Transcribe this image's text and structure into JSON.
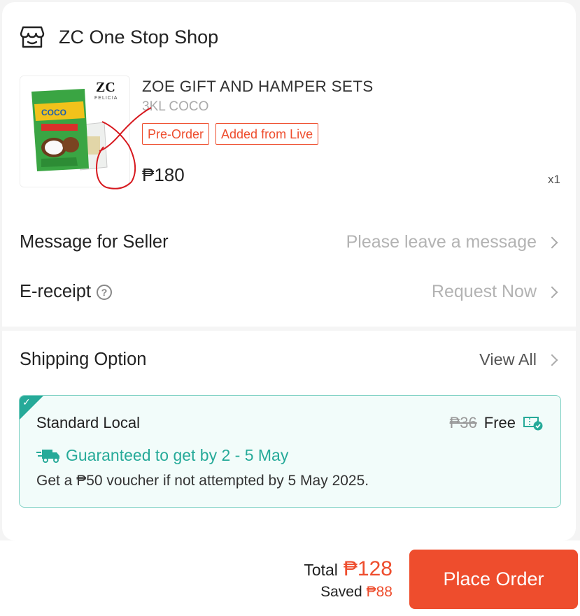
{
  "shop": {
    "name": "ZC One Stop Shop",
    "icon": "store-icon"
  },
  "product": {
    "brand_logo": "ZC",
    "brand_sub": "FELICIA",
    "title": "ZOE GIFT AND HAMPER SETS",
    "variant": "3KL COCO",
    "tags": [
      "Pre-Order",
      "Added from Live"
    ],
    "price": "₱180",
    "quantity": "x1"
  },
  "message_row": {
    "label": "Message for Seller",
    "placeholder": "Please leave a message"
  },
  "ereceipt_row": {
    "label": "E-receipt",
    "help_icon": "?",
    "action": "Request Now"
  },
  "shipping": {
    "title": "Shipping Option",
    "view_all": "View All",
    "option": {
      "name": "Standard Local",
      "old_price": "₱36",
      "price": "Free",
      "guarantee": "Guaranteed to get by 2 - 5 May",
      "voucher_note": "Get a ₱50 voucher if not attempted by 5 May 2025."
    }
  },
  "footer": {
    "total_label": "Total",
    "total_amount": "₱128",
    "saved_label": "Saved",
    "saved_amount": "₱88",
    "place_order": "Place Order"
  },
  "colors": {
    "accent": "#ee4d2d",
    "teal": "#26aa99"
  }
}
